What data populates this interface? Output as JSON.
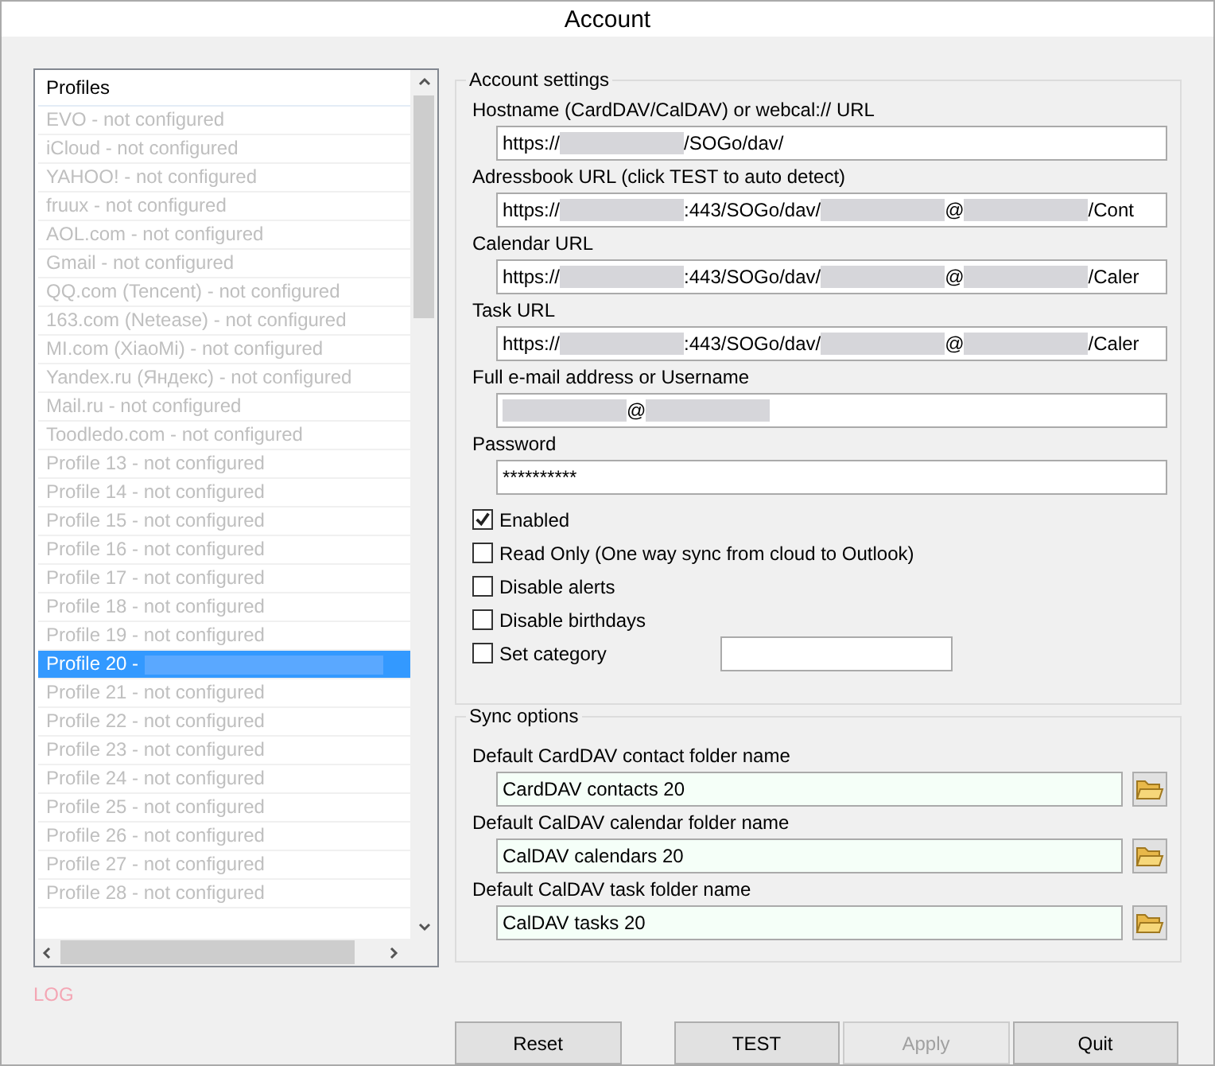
{
  "window": {
    "title": "Account"
  },
  "profiles": {
    "header": "Profiles",
    "items": [
      {
        "parts": [
          {
            "kind": "text",
            "text": "EVO - not configured"
          }
        ],
        "selected": false
      },
      {
        "parts": [
          {
            "kind": "text",
            "text": "iCloud - not configured"
          }
        ],
        "selected": false
      },
      {
        "parts": [
          {
            "kind": "text",
            "text": "YAHOO! - not configured"
          }
        ],
        "selected": false
      },
      {
        "parts": [
          {
            "kind": "text",
            "text": "fruux - not configured"
          }
        ],
        "selected": false
      },
      {
        "parts": [
          {
            "kind": "text",
            "text": "AOL.com - not configured"
          }
        ],
        "selected": false
      },
      {
        "parts": [
          {
            "kind": "text",
            "text": "Gmail - not configured"
          }
        ],
        "selected": false
      },
      {
        "parts": [
          {
            "kind": "text",
            "text": "QQ.com (Tencent) - not configured"
          }
        ],
        "selected": false
      },
      {
        "parts": [
          {
            "kind": "text",
            "text": "163.com (Netease) - not configured"
          }
        ],
        "selected": false
      },
      {
        "parts": [
          {
            "kind": "text",
            "text": "MI.com (XiaoMi) - not configured"
          }
        ],
        "selected": false
      },
      {
        "parts": [
          {
            "kind": "text",
            "text": "Yandex.ru (Яндекс) - not configured"
          }
        ],
        "selected": false
      },
      {
        "parts": [
          {
            "kind": "text",
            "text": "Mail.ru - not configured"
          }
        ],
        "selected": false
      },
      {
        "parts": [
          {
            "kind": "text",
            "text": "Toodledo.com - not configured"
          }
        ],
        "selected": false
      },
      {
        "parts": [
          {
            "kind": "text",
            "text": "Profile 13 - not configured"
          }
        ],
        "selected": false
      },
      {
        "parts": [
          {
            "kind": "text",
            "text": "Profile 14 - not configured"
          }
        ],
        "selected": false
      },
      {
        "parts": [
          {
            "kind": "text",
            "text": "Profile 15 - not configured"
          }
        ],
        "selected": false
      },
      {
        "parts": [
          {
            "kind": "text",
            "text": "Profile 16 - not configured"
          }
        ],
        "selected": false
      },
      {
        "parts": [
          {
            "kind": "text",
            "text": "Profile 17 - not configured"
          }
        ],
        "selected": false
      },
      {
        "parts": [
          {
            "kind": "text",
            "text": "Profile 18 - not configured"
          }
        ],
        "selected": false
      },
      {
        "parts": [
          {
            "kind": "text",
            "text": "Profile 19 - not configured"
          }
        ],
        "selected": false
      },
      {
        "parts": [
          {
            "kind": "text",
            "text": "Profile 20 -"
          },
          {
            "kind": "redacted"
          }
        ],
        "selected": true
      },
      {
        "parts": [
          {
            "kind": "text",
            "text": "Profile 21 - not configured"
          }
        ],
        "selected": false
      },
      {
        "parts": [
          {
            "kind": "text",
            "text": "Profile 22 - not configured"
          }
        ],
        "selected": false
      },
      {
        "parts": [
          {
            "kind": "text",
            "text": "Profile 23 - not configured"
          }
        ],
        "selected": false
      },
      {
        "parts": [
          {
            "kind": "text",
            "text": "Profile 24 - not configured"
          }
        ],
        "selected": false
      },
      {
        "parts": [
          {
            "kind": "text",
            "text": "Profile 25 - not configured"
          }
        ],
        "selected": false
      },
      {
        "parts": [
          {
            "kind": "text",
            "text": "Profile 26 - not configured"
          }
        ],
        "selected": false
      },
      {
        "parts": [
          {
            "kind": "text",
            "text": "Profile 27 - not configured"
          }
        ],
        "selected": false
      },
      {
        "parts": [
          {
            "kind": "text",
            "text": "Profile 28 - not configured"
          }
        ],
        "selected": false
      }
    ]
  },
  "log": "LOG",
  "account_settings": {
    "title": "Account settings",
    "fields": [
      {
        "label": "Hostname (CardDAV/CalDAV) or webcal:// URL",
        "parts": [
          {
            "kind": "text",
            "text": "https://"
          },
          {
            "kind": "redacted"
          },
          {
            "kind": "text",
            "text": "/SOGo/dav/"
          }
        ]
      },
      {
        "label": "Adressbook URL (click TEST to auto detect)",
        "parts": [
          {
            "kind": "text",
            "text": "https://"
          },
          {
            "kind": "redacted"
          },
          {
            "kind": "text",
            "text": ":443/SOGo/dav/"
          },
          {
            "kind": "redacted"
          },
          {
            "kind": "text",
            "text": "@"
          },
          {
            "kind": "redacted"
          },
          {
            "kind": "text",
            "text": "/Cont"
          }
        ]
      },
      {
        "label": "Calendar URL",
        "parts": [
          {
            "kind": "text",
            "text": "https://"
          },
          {
            "kind": "redacted"
          },
          {
            "kind": "text",
            "text": ":443/SOGo/dav/"
          },
          {
            "kind": "redacted"
          },
          {
            "kind": "text",
            "text": "@"
          },
          {
            "kind": "redacted"
          },
          {
            "kind": "text",
            "text": "/Caler"
          }
        ]
      },
      {
        "label": "Task URL",
        "parts": [
          {
            "kind": "text",
            "text": "https://"
          },
          {
            "kind": "redacted"
          },
          {
            "kind": "text",
            "text": ":443/SOGo/dav/"
          },
          {
            "kind": "redacted"
          },
          {
            "kind": "text",
            "text": "@"
          },
          {
            "kind": "redacted"
          },
          {
            "kind": "text",
            "text": "/Caler"
          }
        ]
      },
      {
        "label": "Full e-mail address or Username",
        "parts": [
          {
            "kind": "redacted"
          },
          {
            "kind": "text",
            "text": "@"
          },
          {
            "kind": "redacted"
          }
        ]
      },
      {
        "label": "Password",
        "parts": [
          {
            "kind": "text",
            "text": "**********"
          }
        ]
      }
    ],
    "options": [
      {
        "label": "Enabled",
        "checked": true
      },
      {
        "label": "Read Only (One way sync from cloud to Outlook)",
        "checked": false
      },
      {
        "label": "Disable alerts",
        "checked": false
      },
      {
        "label": "Disable birthdays",
        "checked": false
      },
      {
        "label": "Set category",
        "checked": false,
        "has_field": true
      }
    ]
  },
  "sync_options": {
    "title": "Sync options",
    "folders": [
      {
        "label": "Default CardDAV contact folder name",
        "value": "CardDAV contacts 20"
      },
      {
        "label": "Default CalDAV calendar folder name",
        "value": "CalDAV calendars 20"
      },
      {
        "label": "Default CalDAV task folder name",
        "value": "CalDAV tasks 20"
      }
    ]
  },
  "buttons": [
    {
      "label": "Reset",
      "disabled": false
    },
    {
      "label": "TEST",
      "disabled": false
    },
    {
      "label": "Apply",
      "disabled": true
    },
    {
      "label": "Quit",
      "disabled": false
    }
  ]
}
